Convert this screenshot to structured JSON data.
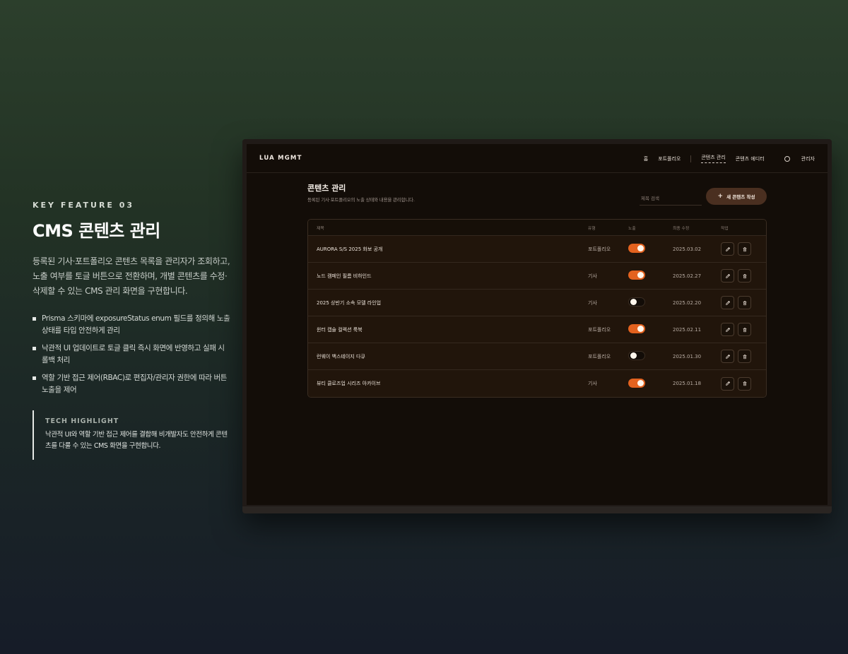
{
  "feature": {
    "eyebrow": "KEY FEATURE 03",
    "title": "CMS 콘텐츠 관리",
    "description": "등록된 기사·포트폴리오 콘텐츠 목록을 관리자가 조회하고, 노출 여부를 토글 버튼으로 전환하며, 개별 콘텐츠를 수정·삭제할 수 있는 CMS 관리 화면을 구현합니다.",
    "bullets": [
      "Prisma 스키마에 exposureStatus enum 필드를 정의해 노출 상태를 타입 안전하게 관리",
      "낙관적 UI 업데이트로 토글 클릭 즉시 화면에 반영하고 실패 시 롤백 처리",
      "역할 기반 접근 제어(RBAC)로 편집자/관리자 권한에 따라 버튼 노출을 제어"
    ],
    "highlight_title": "TECH HIGHLIGHT",
    "highlight_text": "낙관적 UI와 역할 기반 접근 제어를 결합해 비개발자도 안전하게 콘텐츠를 다룰 수 있는 CMS 화면을 구현합니다."
  },
  "app": {
    "brand": "LUA MGMT",
    "nav": [
      "홈",
      "포트폴리오",
      "콘텐츠 관리",
      "콘텐츠 에디터"
    ],
    "admin_label": "관리자",
    "page_title": "콘텐츠 관리",
    "page_subtitle": "등록된 기사·포트폴리오의 노출 상태와 내용을 관리합니다.",
    "search_placeholder": "제목 검색",
    "new_button": "새 콘텐츠 작성",
    "columns": [
      "제목",
      "유형",
      "노출",
      "최종 수정",
      "작업"
    ],
    "rows": [
      {
        "title": "AURORA S/S 2025 화보 공개",
        "type": "포트폴리오",
        "exposed": true,
        "date": "2025.03.02"
      },
      {
        "title": "노드 캠페인 필름 비하인드",
        "type": "기사",
        "exposed": true,
        "date": "2025.02.27"
      },
      {
        "title": "2025 상반기 소속 모델 라인업",
        "type": "기사",
        "exposed": false,
        "date": "2025.02.20"
      },
      {
        "title": "윈터 캡슐 컬렉션 룩북",
        "type": "포트폴리오",
        "exposed": true,
        "date": "2025.02.11"
      },
      {
        "title": "런웨이 백스테이지 다큐",
        "type": "포트폴리오",
        "exposed": false,
        "date": "2025.01.30"
      },
      {
        "title": "뷰티 클로즈업 시리즈 아카이브",
        "type": "기사",
        "exposed": true,
        "date": "2025.01.18"
      }
    ]
  },
  "colors": {
    "accent": "#e3621f",
    "button_bg": "#4a2f20",
    "screen_bg": "#130d08"
  },
  "icons": [
    "user-circle-icon",
    "plus-icon",
    "pencil-icon",
    "trash-icon"
  ]
}
